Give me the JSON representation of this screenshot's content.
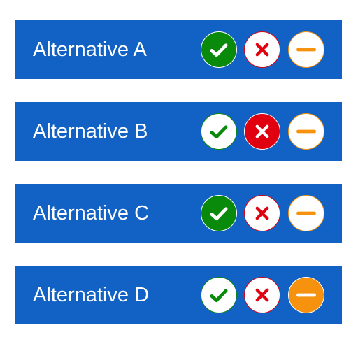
{
  "colors": {
    "row_background": "#1162c4",
    "yes": "#0a8a0a",
    "no": "#e0000f",
    "neutral": "#f7920f",
    "unselected_fill": "#ffffff"
  },
  "options": [
    {
      "key": "yes",
      "icon": "check-icon"
    },
    {
      "key": "no",
      "icon": "x-icon"
    },
    {
      "key": "neutral",
      "icon": "minus-icon"
    }
  ],
  "rows": [
    {
      "label": "Alternative A",
      "selected": "yes"
    },
    {
      "label": "Alternative B",
      "selected": "no"
    },
    {
      "label": "Alternative C",
      "selected": "yes"
    },
    {
      "label": "Alternative D",
      "selected": "neutral"
    }
  ]
}
